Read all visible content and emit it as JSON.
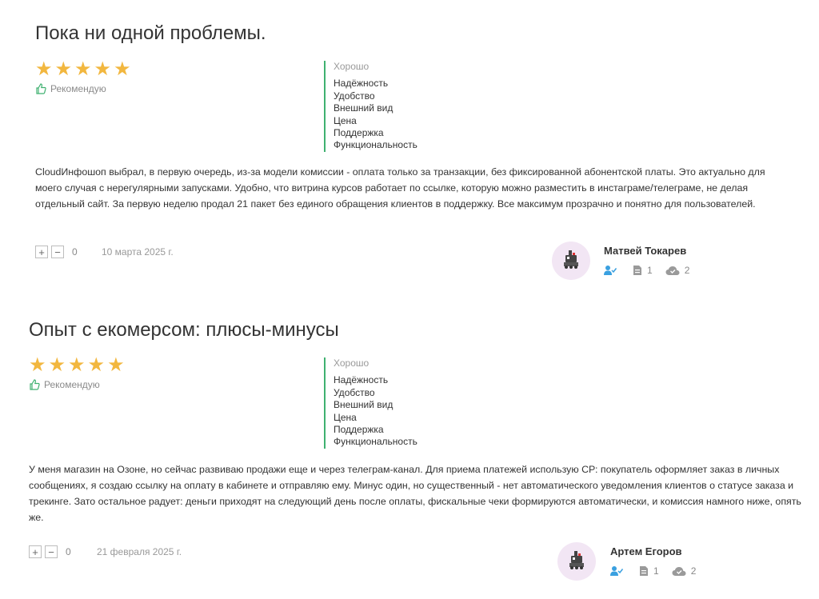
{
  "colors": {
    "star": "#f2b73f",
    "accent_green": "#3fb170",
    "user_blue": "#3aa0e0",
    "muted": "#999999"
  },
  "reviews": [
    {
      "title": "Пока ни одной проблемы.",
      "stars": 5,
      "recommend_label": "Рекомендую",
      "overall": "Хорошо",
      "criteria": [
        "Надёжность",
        "Удобство",
        "Внешний вид",
        "Цена",
        "Поддержка",
        "Функциональность"
      ],
      "body": "CloudИнфошоп выбрал, в первую очередь, из-за модели комиссии - оплата только за транзакции, без фиксированной абонентской платы. Это актуально для моего случая с нерегулярными запусками. Удобно, что витрина курсов работает по ссылке, которую можно разместить в инстаграме/телеграме, не делая отдельный сайт. За первую неделю продал 21 пакет без единого обращения клиентов в поддержку. Все максимум прозрачно и понятно для пользователей.",
      "plus": "+",
      "minus": "−",
      "votes": "0",
      "date": "10 марта 2025 г.",
      "author": {
        "name": "Матвей Токарев",
        "reviews": "1",
        "uploads": "2"
      }
    },
    {
      "title": "Опыт с екомерсом: плюсы-минусы",
      "stars": 5,
      "recommend_label": "Рекомендую",
      "overall": "Хорошо",
      "criteria": [
        "Надёжность",
        "Удобство",
        "Внешний вид",
        "Цена",
        "Поддержка",
        "Функциональность"
      ],
      "body": "У меня магазин на Озоне, но сейчас развиваю продажи еще и через телеграм-канал. Для приема платежей использую СР: покупатель оформляет заказ в личных сообщениях, я создаю ссылку на оплату в кабинете и отправляю ему. Минус один, но существенный - нет автоматического уведомления клиентов о статусе заказа и трекинге. Зато остальное радует: деньги приходят на следующий день после оплаты, фискальные чеки формируются автоматически, и комиссия намного ниже, опять же.",
      "plus": "+",
      "minus": "−",
      "votes": "0",
      "date": "21 февраля 2025 г.",
      "author": {
        "name": "Артем Егоров",
        "reviews": "1",
        "uploads": "2"
      }
    }
  ]
}
